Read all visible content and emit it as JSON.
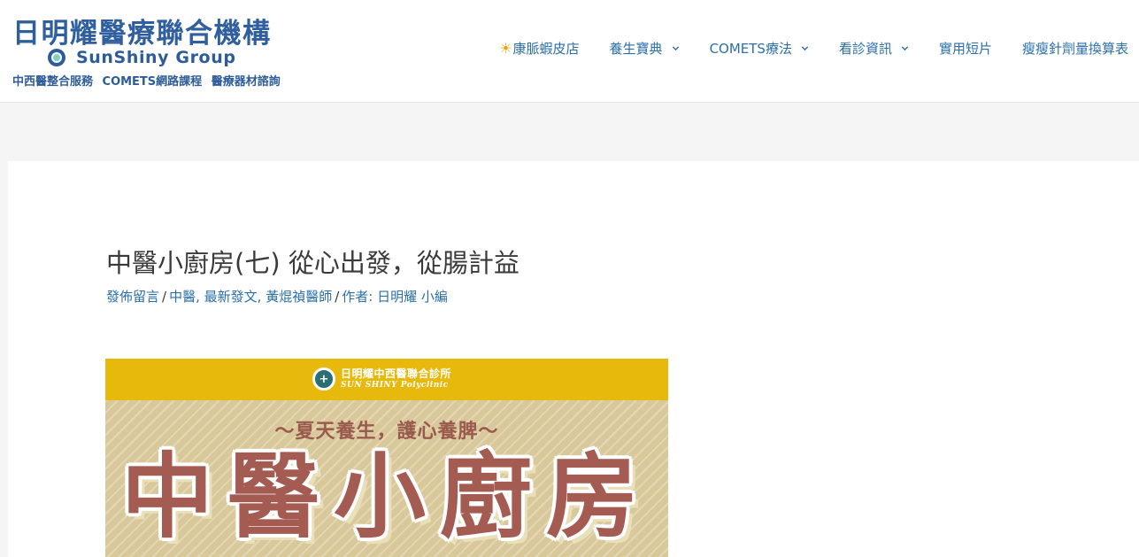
{
  "header": {
    "logo": {
      "title": "日明耀醫療聯合機構",
      "group_name": "SunShiny Group",
      "services": "中西醫整合服務 COMETS網路課程 醫療器材諮詢"
    },
    "nav": {
      "items": [
        {
          "label": "康脈蝦皮店",
          "icon": "sun-icon",
          "has_dropdown": false
        },
        {
          "label": "養生寶典",
          "has_dropdown": true
        },
        {
          "label": "COMETS療法",
          "has_dropdown": true
        },
        {
          "label": "看診資訊",
          "has_dropdown": true
        },
        {
          "label": "實用短片",
          "has_dropdown": false
        },
        {
          "label": "瘦瘦針劑量換算表",
          "has_dropdown": false
        }
      ]
    }
  },
  "post": {
    "title": "中醫小廚房(七) 從心出發，從腸計益",
    "meta": {
      "comments": "發佈留言",
      "separator": "/",
      "categories": [
        "中醫",
        "最新發文",
        "黃焜禎醫師"
      ],
      "author_prefix": "作者:",
      "author": "日明耀 小編"
    }
  },
  "banner": {
    "clinic_name": "日明耀中西醫聯合診所",
    "clinic_en": "SUN SHINY Polyclinic",
    "subtitle": "～夏天養生，護心養脾～",
    "headline": "中醫小廚房"
  },
  "colors": {
    "link": "#2b6fa8",
    "text": "#3a3a3a",
    "banner_yellow": "#e8b90d",
    "banner_text": "#a45c52",
    "brand_blue": "#2d5c98"
  }
}
